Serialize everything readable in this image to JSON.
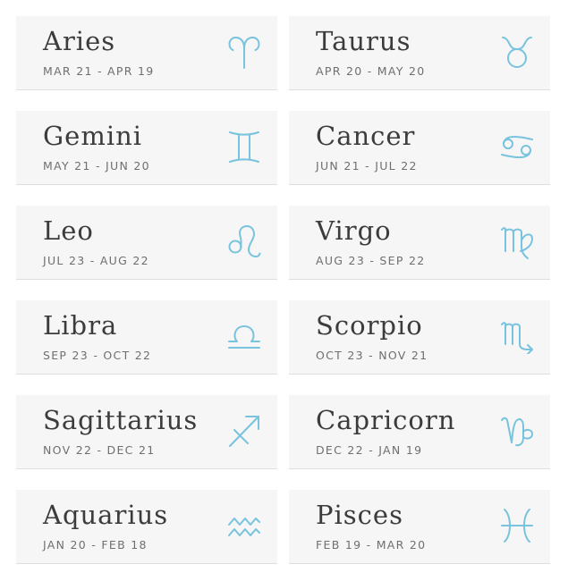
{
  "accent_color": "#78c3de",
  "signs": [
    {
      "name": "Aries",
      "dates": "MAR 21 - APR 19",
      "icon": "aries-icon"
    },
    {
      "name": "Taurus",
      "dates": "APR 20 - MAY 20",
      "icon": "taurus-icon"
    },
    {
      "name": "Gemini",
      "dates": "MAY 21 - JUN 20",
      "icon": "gemini-icon"
    },
    {
      "name": "Cancer",
      "dates": "JUN 21 - JUL 22",
      "icon": "cancer-icon"
    },
    {
      "name": "Leo",
      "dates": "JUL 23 - AUG 22",
      "icon": "leo-icon"
    },
    {
      "name": "Virgo",
      "dates": "AUG 23 - SEP 22",
      "icon": "virgo-icon"
    },
    {
      "name": "Libra",
      "dates": "SEP 23 - OCT 22",
      "icon": "libra-icon"
    },
    {
      "name": "Scorpio",
      "dates": "OCT 23 - NOV 21",
      "icon": "scorpio-icon"
    },
    {
      "name": "Sagittarius",
      "dates": "NOV 22 - DEC 21",
      "icon": "sagittarius-icon"
    },
    {
      "name": "Capricorn",
      "dates": "DEC 22 - JAN 19",
      "icon": "capricorn-icon"
    },
    {
      "name": "Aquarius",
      "dates": "JAN 20 - FEB 18",
      "icon": "aquarius-icon"
    },
    {
      "name": "Pisces",
      "dates": "FEB 19 - MAR 20",
      "icon": "pisces-icon"
    }
  ]
}
